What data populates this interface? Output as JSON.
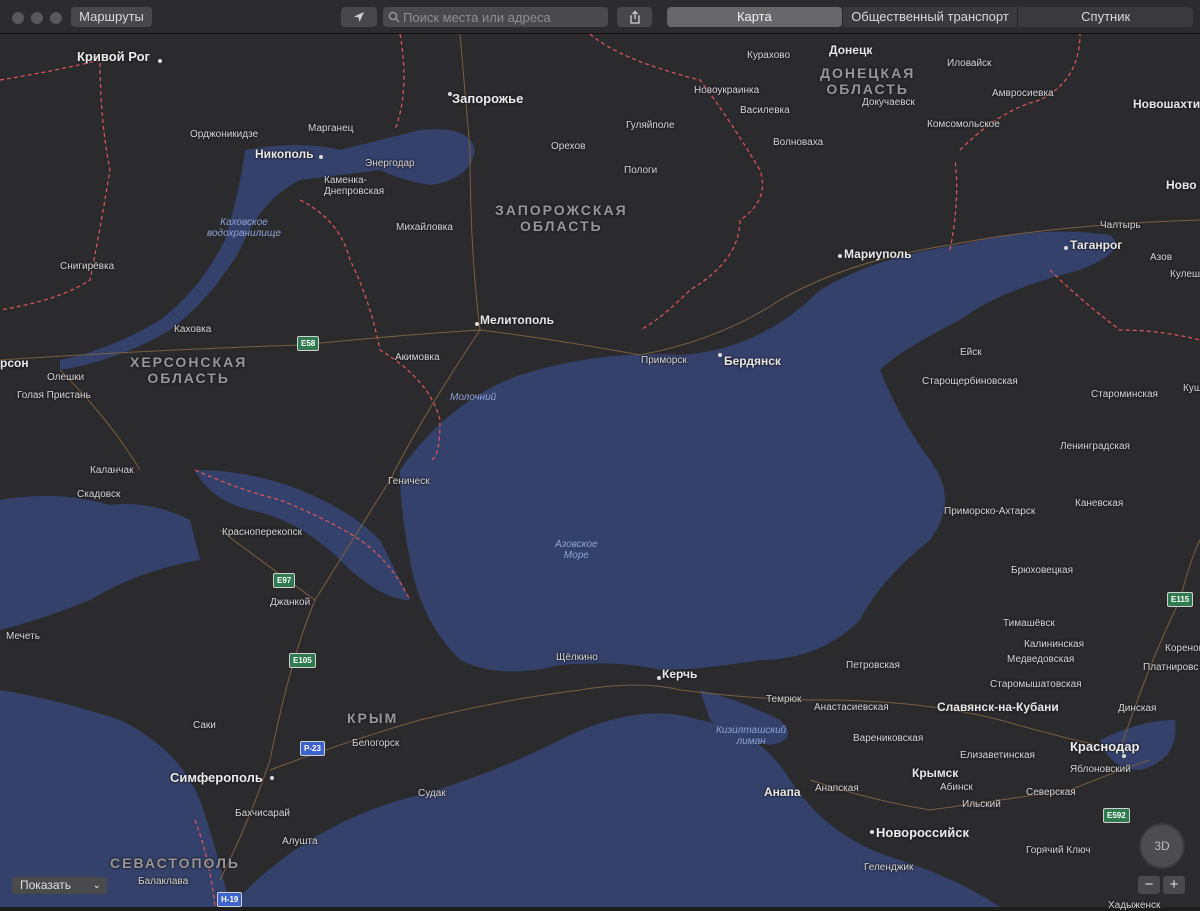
{
  "toolbar": {
    "directions_label": "Маршруты",
    "search_placeholder": "Поиск места или адреса",
    "segments": [
      "Карта",
      "Общественный транспорт",
      "Спутник"
    ]
  },
  "colors": {
    "land": "#2b2b2e",
    "water": "#34416b",
    "border": "#e0575b",
    "road": "#7a6041"
  },
  "map": {
    "regions": [
      "ЗАПОРОЖСКАЯ",
      "ОБЛАСТЬ",
      "ХЕРСОНСКАЯ",
      "ОБЛАСТЬ",
      "ДОНЕЦКАЯ",
      "ОБЛАСТЬ",
      "КРЫМ",
      "СЕВАСТОПОЛЬ"
    ],
    "water": [
      "Каховское",
      "водохранилище",
      "Молочний",
      "Азовское",
      "Море",
      "Кизилташский",
      "лиман"
    ],
    "cities": [
      "Кривой Рог",
      "Запорожье",
      "Донецк",
      "Никополь",
      "Мелитополь",
      "Бердянск",
      "Мариуполь",
      "Таганрог",
      "Симферополь",
      "Керчь",
      "Новороссийск",
      "Краснодар",
      "Новошахти",
      "Ново",
      "рсон"
    ],
    "towns": [
      "Орджоникидзе",
      "Марганец",
      "Энергодар",
      "Каменка-",
      "Днепровская",
      "Михайловка",
      "Орехов",
      "Гуляйполе",
      "Пологи",
      "Курахово",
      "Новоукраинка",
      "Василевка",
      "Волноваха",
      "Иловайск",
      "Амвросиевка",
      "Докучаевск",
      "Комсомольское",
      "Снигирёвка",
      "Каховка",
      "Олешки",
      "Голая Пристань",
      "Акимовка",
      "Приморск",
      "Каланчак",
      "Скадовск",
      "Геническ",
      "Красноперекопск",
      "Джанкой",
      "Мечеть",
      "Саки",
      "Белогорск",
      "Бахчисарай",
      "Алушта",
      "Судак",
      "Балаклава",
      "Щёлкино",
      "Ейск",
      "Старощербиновская",
      "Староминская",
      "Ленинградская",
      "Каневская",
      "Приморско-Ахтарск",
      "Брюховецкая",
      "Тимашёвск",
      "Калининская",
      "Медведовская",
      "Старомышатовская",
      "Петровская",
      "Темрюк",
      "Анастасиевская",
      "Славянск-на-Кубани",
      "Варениковская",
      "Елизаветинская",
      "Крымск",
      "Абинск",
      "Ильский",
      "Северская",
      "Анапа",
      "Анапская",
      "Геленджик",
      "Горячий Ключ",
      "Хадыженск",
      "Яблоновский",
      "Чалтырь",
      "Азов",
      "Кулеш",
      "Кореново",
      "Платнировс",
      "Динская",
      "Куща"
    ],
    "shields": [
      "E58",
      "E97",
      "E105",
      "P-23",
      "H-19",
      "E115",
      "E592"
    ]
  },
  "controls": {
    "show_label": "Показать",
    "compass_label": "3D",
    "zoom_out": "−",
    "zoom_in": "+"
  }
}
